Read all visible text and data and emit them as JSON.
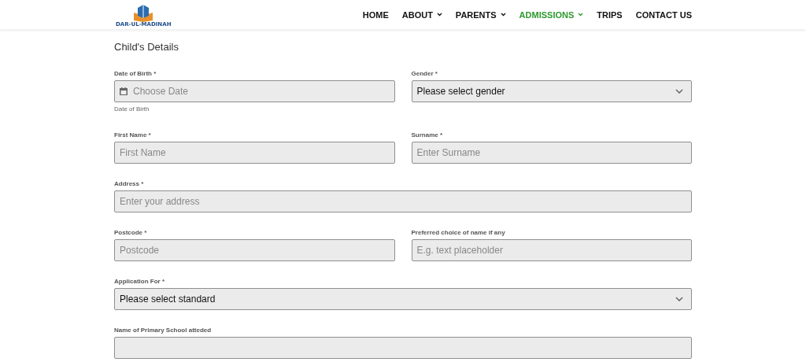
{
  "header": {
    "logo_text": "DAR-UL-MADINAH",
    "nav": [
      {
        "label": "HOME",
        "dropdown": false,
        "selected": false
      },
      {
        "label": "ABOUT",
        "dropdown": true,
        "selected": false
      },
      {
        "label": "PARENTS",
        "dropdown": true,
        "selected": false
      },
      {
        "label": "ADMISSIONS",
        "dropdown": true,
        "selected": true
      },
      {
        "label": "TRIPS",
        "dropdown": false,
        "selected": false
      },
      {
        "label": "CONTACT US",
        "dropdown": false,
        "selected": false
      }
    ]
  },
  "section_title": "Child's Details",
  "rows": [
    [
      {
        "kind": "date",
        "label": "Date of Birth *",
        "placeholder": "Choose Date",
        "help": "Date of Birth"
      },
      {
        "kind": "select",
        "label": "Gender *",
        "value": "Please select gender"
      }
    ],
    [
      {
        "kind": "text",
        "label": "First Name *",
        "placeholder": "First Name"
      },
      {
        "kind": "text",
        "label": "Surname *",
        "placeholder": "Enter Surname"
      }
    ],
    [
      {
        "kind": "text",
        "label": "Address *",
        "placeholder": "Enter your address"
      }
    ],
    [
      {
        "kind": "text",
        "label": "Postcode *",
        "placeholder": "Postcode"
      },
      {
        "kind": "text",
        "label": "Preferred choice of name if any",
        "placeholder": "E.g. text placeholder"
      }
    ],
    [
      {
        "kind": "select",
        "label": "Application For *",
        "value": "Please select standard"
      }
    ],
    [
      {
        "kind": "text",
        "label": "Name of Primary School atteded"
      }
    ]
  ]
}
